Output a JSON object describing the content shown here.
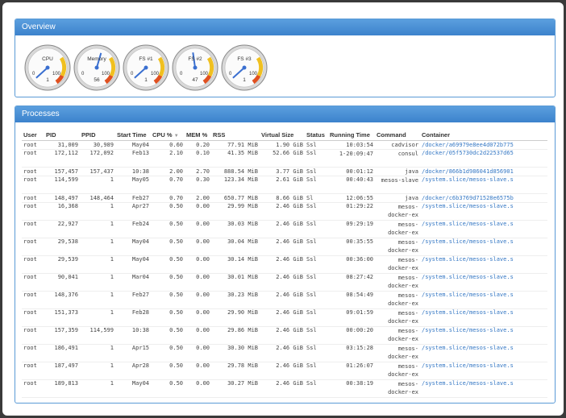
{
  "overview": {
    "title": "Overview",
    "gauges": [
      {
        "label": "CPU",
        "min": "0",
        "max": "100",
        "value": "1",
        "level": 1
      },
      {
        "label": "Memory",
        "min": "0",
        "max": "100",
        "value": "56",
        "level": 56
      },
      {
        "label": "FS #1",
        "min": "0",
        "max": "100",
        "value": "1",
        "level": 1
      },
      {
        "label": "FS #2",
        "min": "0",
        "max": "100",
        "value": "47",
        "level": 47
      },
      {
        "label": "FS #3",
        "min": "0",
        "max": "100",
        "value": "1",
        "level": 1
      }
    ]
  },
  "processes": {
    "title": "Processes",
    "columns": [
      "User",
      "PID",
      "PPID",
      "Start Time",
      "CPU %",
      "MEM %",
      "RSS",
      "Virtual Size",
      "Status",
      "Running Time",
      "Command",
      "Container"
    ],
    "sort_icon": "▼",
    "rows": [
      [
        "root",
        "31,009",
        "30,989",
        "May04",
        "0.60",
        "0.20",
        "77.91 MiB",
        "1.90 GiB",
        "Ssl",
        "10:03:54",
        "cadvisor",
        "/docker/a69979e8ee4d072b775"
      ],
      [
        "root",
        "172,112",
        "172,092",
        "Feb13",
        "2.10",
        "0.10",
        "41.35 MiB",
        "52.66 GiB",
        "Ssl",
        "1-20:09:47",
        "consul",
        "/docker/05f5730dc2d22537d65"
      ],
      [
        "root",
        "157,457",
        "157,437",
        "10:38",
        "2.00",
        "2.70",
        "888.54 MiB",
        "3.77 GiB",
        "Ssl",
        "00:01:12",
        "java",
        "/docker/866b1d986041d856901"
      ],
      [
        "root",
        "114,599",
        "1",
        "May05",
        "0.70",
        "0.30",
        "123.34 MiB",
        "2.61 GiB",
        "Ssl",
        "00:40:43",
        "mesos-slave",
        "/system.slice/mesos-slave.s"
      ],
      [
        "root",
        "148,497",
        "148,464",
        "Feb27",
        "0.70",
        "2.00",
        "650.77 MiB",
        "8.66 GiB",
        "Sl",
        "12:06:55",
        "java",
        "/docker/c6b3769d71528e6575b"
      ],
      [
        "root",
        "16,368",
        "1",
        "Apr27",
        "0.50",
        "0.00",
        "29.99 MiB",
        "2.46 GiB",
        "Ssl",
        "01:29:22",
        "mesos-docker-ex",
        "/system.slice/mesos-slave.s"
      ],
      [
        "root",
        "22,927",
        "1",
        "Feb24",
        "0.50",
        "0.00",
        "30.03 MiB",
        "2.46 GiB",
        "Ssl",
        "09:29:19",
        "mesos-docker-ex",
        "/system.slice/mesos-slave.s"
      ],
      [
        "root",
        "29,538",
        "1",
        "May04",
        "0.50",
        "0.00",
        "30.04 MiB",
        "2.46 GiB",
        "Ssl",
        "00:35:55",
        "mesos-docker-ex",
        "/system.slice/mesos-slave.s"
      ],
      [
        "root",
        "29,539",
        "1",
        "May04",
        "0.50",
        "0.00",
        "30.14 MiB",
        "2.46 GiB",
        "Ssl",
        "00:36:00",
        "mesos-docker-ex",
        "/system.slice/mesos-slave.s"
      ],
      [
        "root",
        "90,041",
        "1",
        "Mar04",
        "0.50",
        "0.00",
        "30.01 MiB",
        "2.46 GiB",
        "Ssl",
        "08:27:42",
        "mesos-docker-ex",
        "/system.slice/mesos-slave.s"
      ],
      [
        "root",
        "148,376",
        "1",
        "Feb27",
        "0.50",
        "0.00",
        "30.23 MiB",
        "2.46 GiB",
        "Ssl",
        "08:54:49",
        "mesos-docker-ex",
        "/system.slice/mesos-slave.s"
      ],
      [
        "root",
        "151,373",
        "1",
        "Feb28",
        "0.50",
        "0.00",
        "29.90 MiB",
        "2.46 GiB",
        "Ssl",
        "09:01:59",
        "mesos-docker-ex",
        "/system.slice/mesos-slave.s"
      ],
      [
        "root",
        "157,359",
        "114,599",
        "10:38",
        "0.50",
        "0.00",
        "29.86 MiB",
        "2.46 GiB",
        "Ssl",
        "00:00:20",
        "mesos-docker-ex",
        "/system.slice/mesos-slave.s"
      ],
      [
        "root",
        "186,491",
        "1",
        "Apr15",
        "0.50",
        "0.00",
        "30.30 MiB",
        "2.46 GiB",
        "Ssl",
        "03:15:28",
        "mesos-docker-ex",
        "/system.slice/mesos-slave.s"
      ],
      [
        "root",
        "187,497",
        "1",
        "Apr28",
        "0.50",
        "0.00",
        "29.78 MiB",
        "2.46 GiB",
        "Ssl",
        "01:26:07",
        "mesos-docker-ex",
        "/system.slice/mesos-slave.s"
      ],
      [
        "root",
        "189,813",
        "1",
        "May04",
        "0.50",
        "0.00",
        "30.27 MiB",
        "2.46 GiB",
        "Ssl",
        "00:38:19",
        "mesos-docker-ex",
        "/system.slice/mesos-slave.s"
      ]
    ]
  }
}
